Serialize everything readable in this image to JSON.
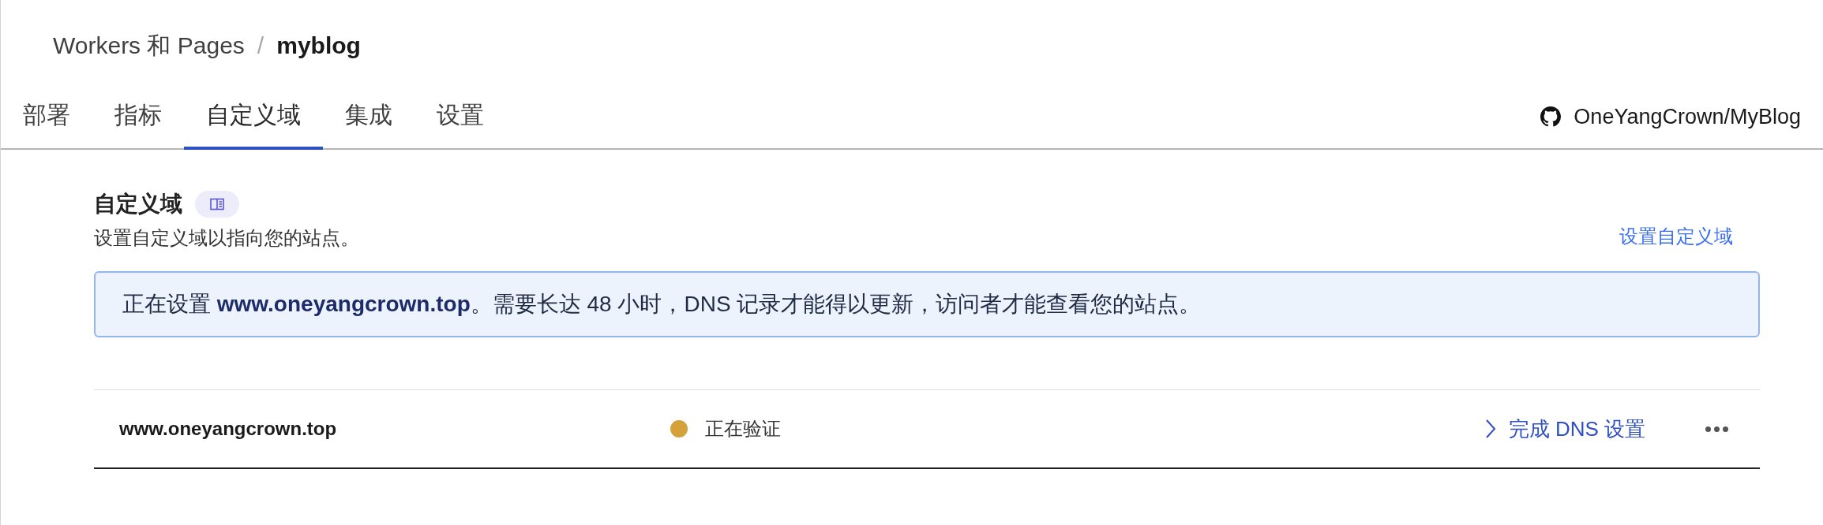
{
  "breadcrumb": {
    "parent": "Workers 和 Pages",
    "separator": "/",
    "current": "myblog"
  },
  "tabs": [
    {
      "label": "部署",
      "selected": false
    },
    {
      "label": "指标",
      "selected": false
    },
    {
      "label": "自定义域",
      "selected": true
    },
    {
      "label": "集成",
      "selected": false
    },
    {
      "label": "设置",
      "selected": false
    }
  ],
  "repository": "OneYangCrown/MyBlog",
  "section": {
    "title": "自定义域",
    "description": "设置自定义域以指向您的站点。",
    "link": "设置自定义域"
  },
  "banner": "正在设置 **www.oneyangcrown.top**。需要长达 48 小时，DNS 记录才能得以更新，访问者才能查看您的站点。",
  "domains": [
    {
      "domain": "www.oneyangcrown.top",
      "status": "正在验证",
      "color": "#d4a13a",
      "action": "完成 DNS 设置"
    }
  ]
}
